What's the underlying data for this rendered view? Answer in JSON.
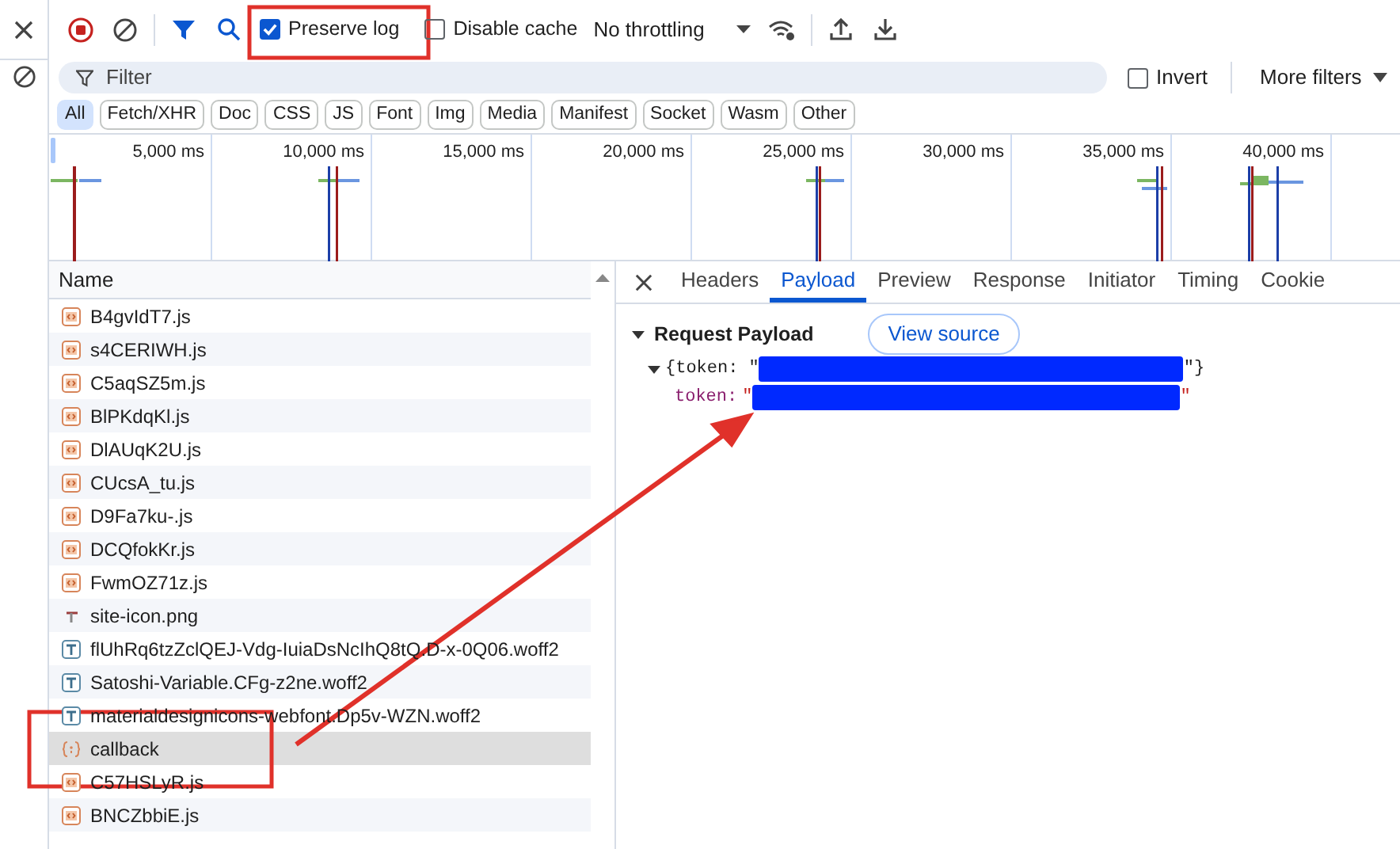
{
  "toolbar": {
    "preserve_log": {
      "label": "Preserve log",
      "checked": true
    },
    "disable_cache": {
      "label": "Disable cache",
      "checked": false
    },
    "throttling": "No throttling"
  },
  "filter": {
    "placeholder": "Filter",
    "invert": {
      "label": "Invert",
      "checked": false
    },
    "more_filters": "More filters"
  },
  "type_filters": [
    {
      "label": "All",
      "selected": true
    },
    {
      "label": "Fetch/XHR",
      "selected": false
    },
    {
      "label": "Doc",
      "selected": false
    },
    {
      "label": "CSS",
      "selected": false
    },
    {
      "label": "JS",
      "selected": false
    },
    {
      "label": "Font",
      "selected": false
    },
    {
      "label": "Img",
      "selected": false
    },
    {
      "label": "Media",
      "selected": false
    },
    {
      "label": "Manifest",
      "selected": false
    },
    {
      "label": "Socket",
      "selected": false
    },
    {
      "label": "Wasm",
      "selected": false
    },
    {
      "label": "Other",
      "selected": false
    }
  ],
  "timeline": {
    "ticks": [
      "5,000 ms",
      "10,000 ms",
      "15,000 ms",
      "20,000 ms",
      "25,000 ms",
      "30,000 ms",
      "35,000 ms",
      "40,000 ms"
    ]
  },
  "requests": {
    "column": "Name",
    "rows": [
      {
        "name": "B4gvIdT7.js",
        "kind": "script",
        "selected": false
      },
      {
        "name": "s4CERIWH.js",
        "kind": "script",
        "selected": false
      },
      {
        "name": "C5aqSZ5m.js",
        "kind": "script",
        "selected": false
      },
      {
        "name": "BlPKdqKl.js",
        "kind": "script",
        "selected": false
      },
      {
        "name": "DlAUqK2U.js",
        "kind": "script",
        "selected": false
      },
      {
        "name": "CUcsA_tu.js",
        "kind": "script",
        "selected": false
      },
      {
        "name": "D9Fa7ku-.js",
        "kind": "script",
        "selected": false
      },
      {
        "name": "DCQfokKr.js",
        "kind": "script",
        "selected": false
      },
      {
        "name": "FwmOZ71z.js",
        "kind": "script",
        "selected": false
      },
      {
        "name": "site-icon.png",
        "kind": "image",
        "selected": false
      },
      {
        "name": "flUhRq6tzZclQEJ-Vdg-IuiaDsNcIhQ8tQ.D-x-0Q06.woff2",
        "kind": "font",
        "selected": false
      },
      {
        "name": "Satoshi-Variable.CFg-z2ne.woff2",
        "kind": "font",
        "selected": false
      },
      {
        "name": "materialdesignicons-webfont.Dp5v-WZN.woff2",
        "kind": "font",
        "selected": false
      },
      {
        "name": "callback",
        "kind": "fetch",
        "selected": true
      },
      {
        "name": "C57HSLyR.js",
        "kind": "script",
        "selected": false
      },
      {
        "name": "BNCZbbiE.js",
        "kind": "script",
        "selected": false
      }
    ]
  },
  "details": {
    "tabs": [
      {
        "label": "Headers",
        "selected": false
      },
      {
        "label": "Payload",
        "selected": true
      },
      {
        "label": "Preview",
        "selected": false
      },
      {
        "label": "Response",
        "selected": false
      },
      {
        "label": "Initiator",
        "selected": false
      },
      {
        "label": "Timing",
        "selected": false
      },
      {
        "label": "Cookie",
        "selected": false
      }
    ],
    "section": {
      "title": "Request Payload",
      "expanded": true
    },
    "view_source": "View source",
    "summary": {
      "open": "{token: \"",
      "close": "\"}",
      "expanded": true
    },
    "field": {
      "key": "token:",
      "open": "\"",
      "close": "\""
    }
  }
}
